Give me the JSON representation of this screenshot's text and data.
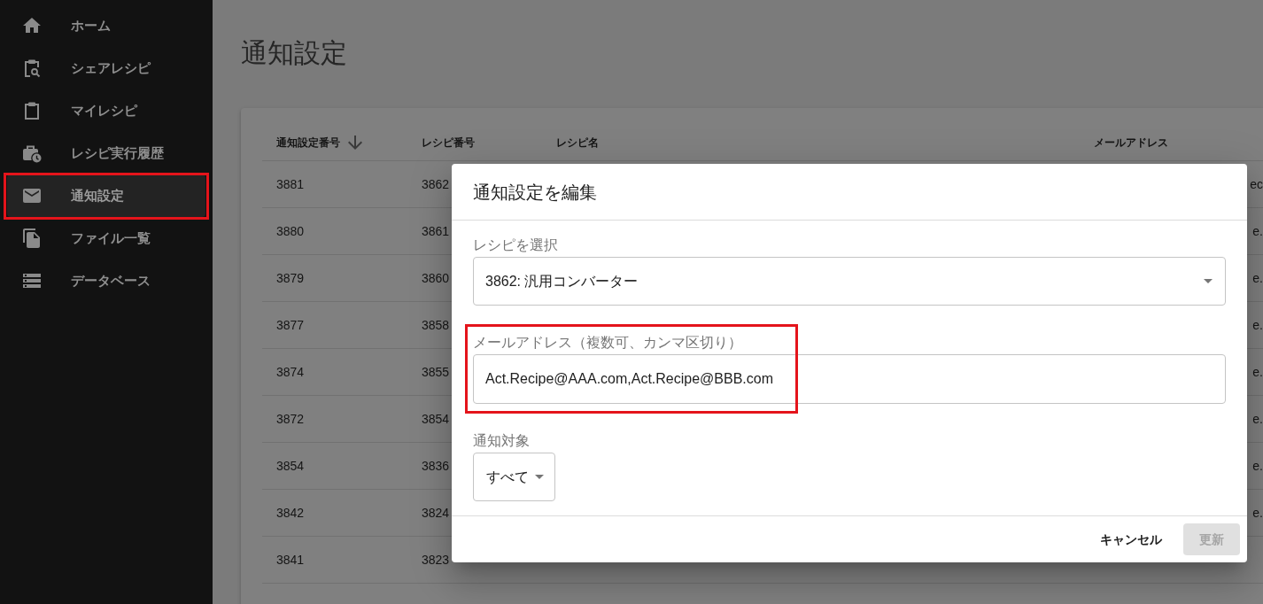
{
  "sidebar": {
    "items": [
      {
        "label": "ホーム",
        "selected": false,
        "highlighted": false
      },
      {
        "label": "シェアレシピ",
        "selected": false,
        "highlighted": false
      },
      {
        "label": "マイレシピ",
        "selected": false,
        "highlighted": false
      },
      {
        "label": "レシピ実行履歴",
        "selected": false,
        "highlighted": false
      },
      {
        "label": "通知設定",
        "selected": true,
        "highlighted": true
      },
      {
        "label": "ファイル一覧",
        "selected": false,
        "highlighted": false
      },
      {
        "label": "データベース",
        "selected": false,
        "highlighted": false
      }
    ]
  },
  "page": {
    "title": "通知設定"
  },
  "table": {
    "columns": [
      {
        "label": "通知設定番号",
        "sorted": true
      },
      {
        "label": "レシピ番号",
        "sorted": false
      },
      {
        "label": "レシピ名",
        "sorted": false
      },
      {
        "label": "メールアドレス",
        "sorted": false
      }
    ],
    "rows": [
      {
        "notification_no": "3881",
        "recipe_no": "3862",
        "email": "ec"
      },
      {
        "notification_no": "3880",
        "recipe_no": "3861",
        "email": "e."
      },
      {
        "notification_no": "3879",
        "recipe_no": "3860",
        "email": "e."
      },
      {
        "notification_no": "3877",
        "recipe_no": "3858",
        "email": "e."
      },
      {
        "notification_no": "3874",
        "recipe_no": "3855",
        "email": "e."
      },
      {
        "notification_no": "3872",
        "recipe_no": "3854",
        "email": "e."
      },
      {
        "notification_no": "3854",
        "recipe_no": "3836",
        "email": "e."
      },
      {
        "notification_no": "3842",
        "recipe_no": "3824",
        "email": "e."
      },
      {
        "notification_no": "3841",
        "recipe_no": "3823"
      }
    ]
  },
  "dialog": {
    "title": "通知設定を編集",
    "fields": [
      {
        "kind": "select",
        "label": "レシピを選択",
        "value": "3862: 汎用コンバーター",
        "highlighted": false
      },
      {
        "kind": "text",
        "label": "メールアドレス（複数可、カンマ区切り）",
        "value": "Act.Recipe@AAA.com,Act.Recipe@BBB.com",
        "highlighted": true
      },
      {
        "kind": "dropdown",
        "label": "通知対象",
        "value": "すべて",
        "highlighted": false
      }
    ],
    "buttons": [
      {
        "kind": "text",
        "label": "キャンセル",
        "disabled": false
      },
      {
        "kind": "contained",
        "label": "更新",
        "disabled": true
      }
    ]
  }
}
